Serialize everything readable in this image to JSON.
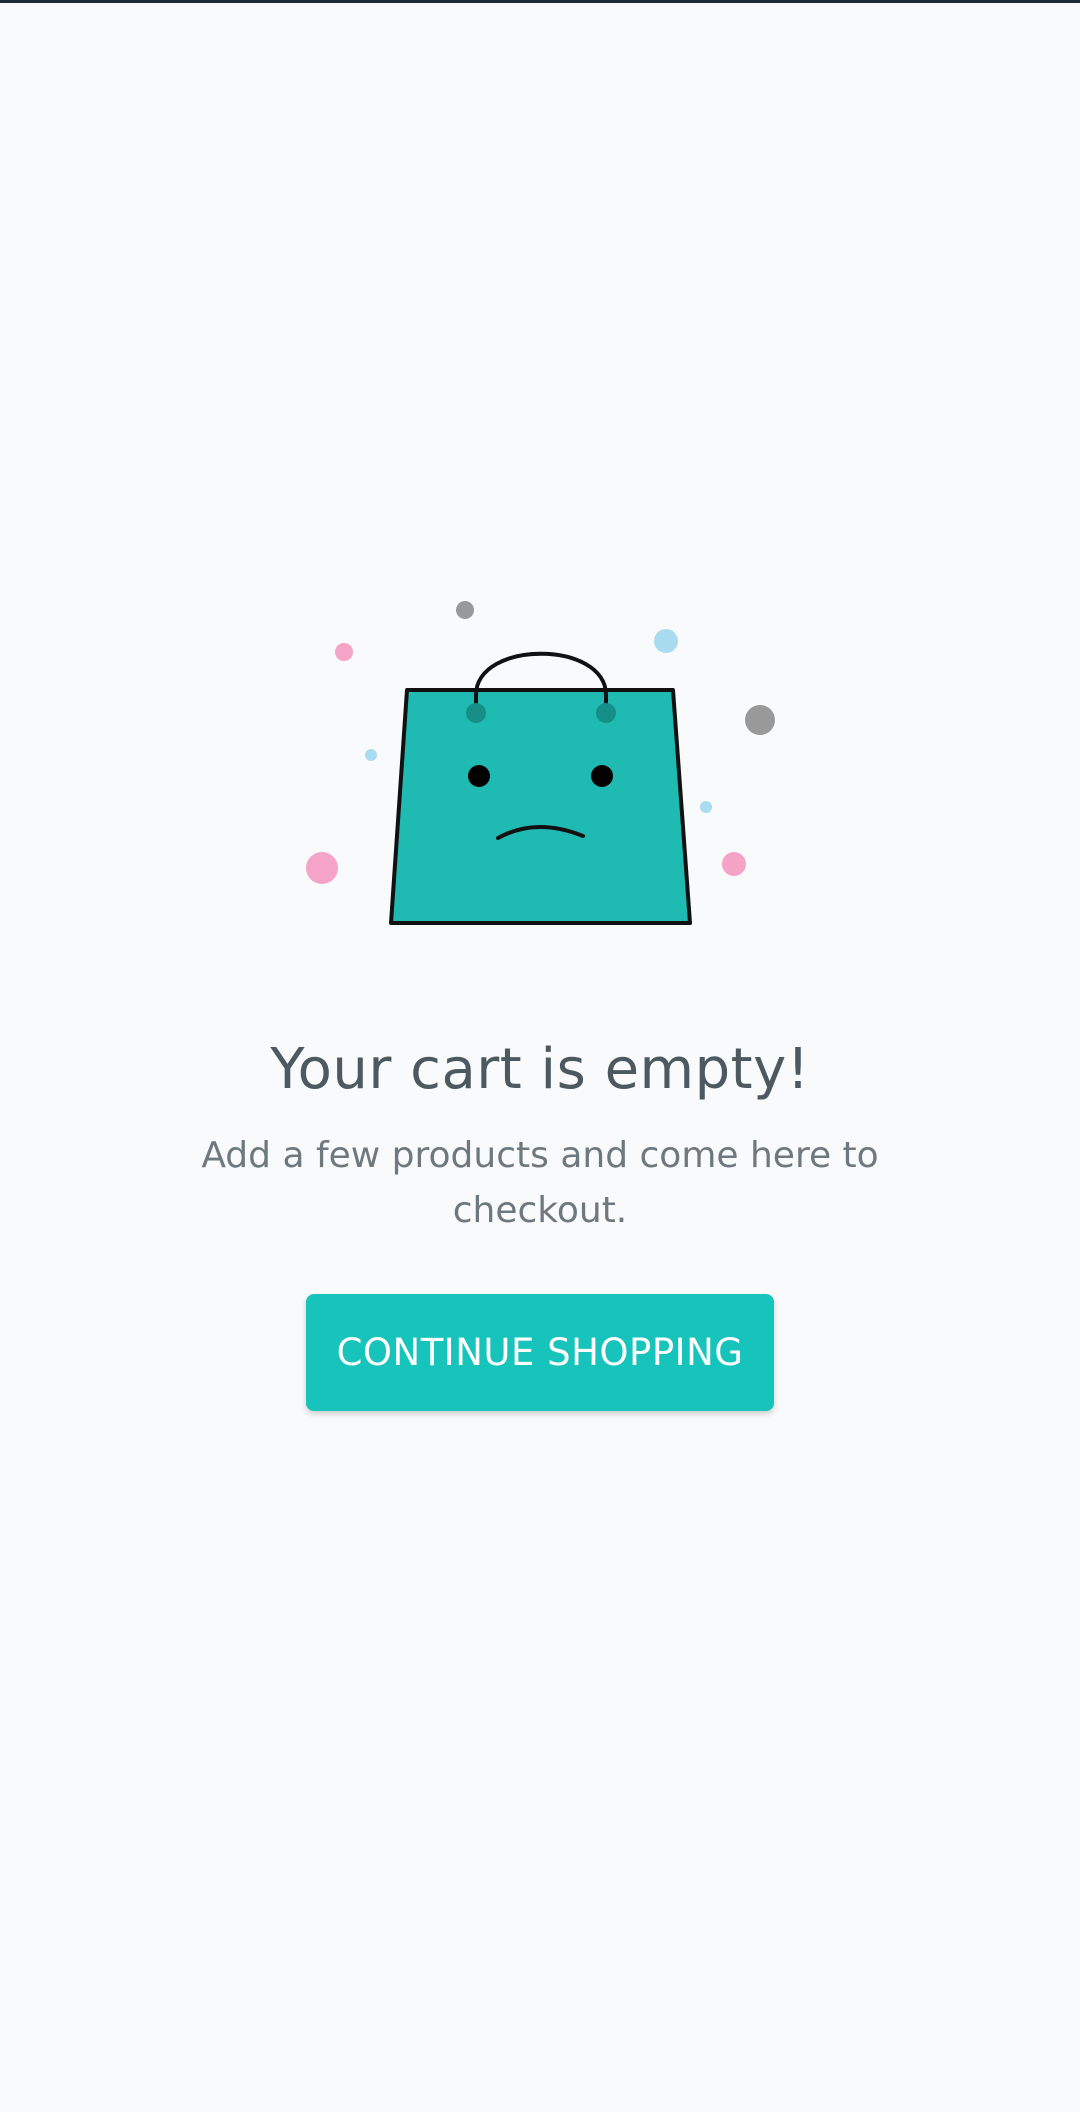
{
  "empty_cart": {
    "title": "Your cart is empty!",
    "subtitle": "Add a few products and come here to checkout.",
    "button_label": "CONTINUE SHOPPING",
    "illustration_icon": "sad-shopping-bag-icon"
  },
  "colors": {
    "background": "#f9fafc",
    "accent": "#16c4bb",
    "bag": "#1fbab1",
    "title": "#4d5961",
    "subtitle": "#6e787f",
    "dot_pink": "#f5a3c7",
    "dot_blue": "#a9dcf0",
    "dot_gray": "#999999"
  }
}
